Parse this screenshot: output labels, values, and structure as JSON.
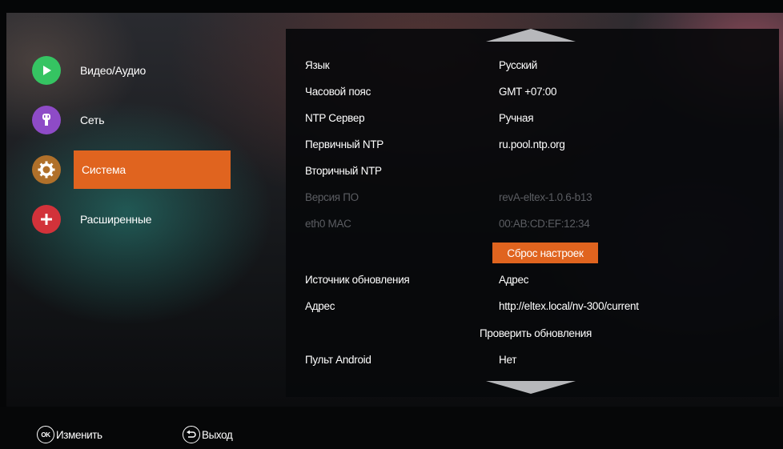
{
  "menu": {
    "items": [
      {
        "label": "Видео/Аудио",
        "icon": "play-icon",
        "active": false
      },
      {
        "label": "Сеть",
        "icon": "network-icon",
        "active": false
      },
      {
        "label": "Система",
        "icon": "gear-icon",
        "active": true
      },
      {
        "label": "Расширенные",
        "icon": "plus-icon",
        "active": false
      }
    ]
  },
  "settings": {
    "language": {
      "label": "Язык",
      "value": "Русский"
    },
    "timezone": {
      "label": "Часовой пояс",
      "value": "GMT +07:00"
    },
    "ntp_server": {
      "label": "NTP Сервер",
      "value": "Ручная"
    },
    "primary_ntp": {
      "label": "Первичный NTP",
      "value": "ru.pool.ntp.org"
    },
    "secondary_ntp": {
      "label": "Вторичный NTP",
      "value": ""
    },
    "firmware_version": {
      "label": "Версия ПО",
      "value": "revA-eltex-1.0.6-b13"
    },
    "eth0_mac": {
      "label": "eth0 MAC",
      "value": "00:AB:CD:EF:12:34"
    },
    "reset_button": "Сброс настроек",
    "update_source": {
      "label": "Источник обновления",
      "value": "Адрес"
    },
    "address": {
      "label": "Адрес",
      "value": "http://eltex.local/nv-300/current"
    },
    "check_updates": "Проверить обновления",
    "android_remote": {
      "label": "Пульт Android",
      "value": "Нет"
    }
  },
  "footer": {
    "ok_key": "OK",
    "change_label": "Изменить",
    "exit_label": "Выход"
  },
  "colors": {
    "accent": "#e0641f",
    "disabled_text": "#5b5d62",
    "icon_play": "#35c462",
    "icon_network": "#8e4bc7",
    "icon_system": "#b0702a",
    "icon_advanced": "#d2323a"
  }
}
